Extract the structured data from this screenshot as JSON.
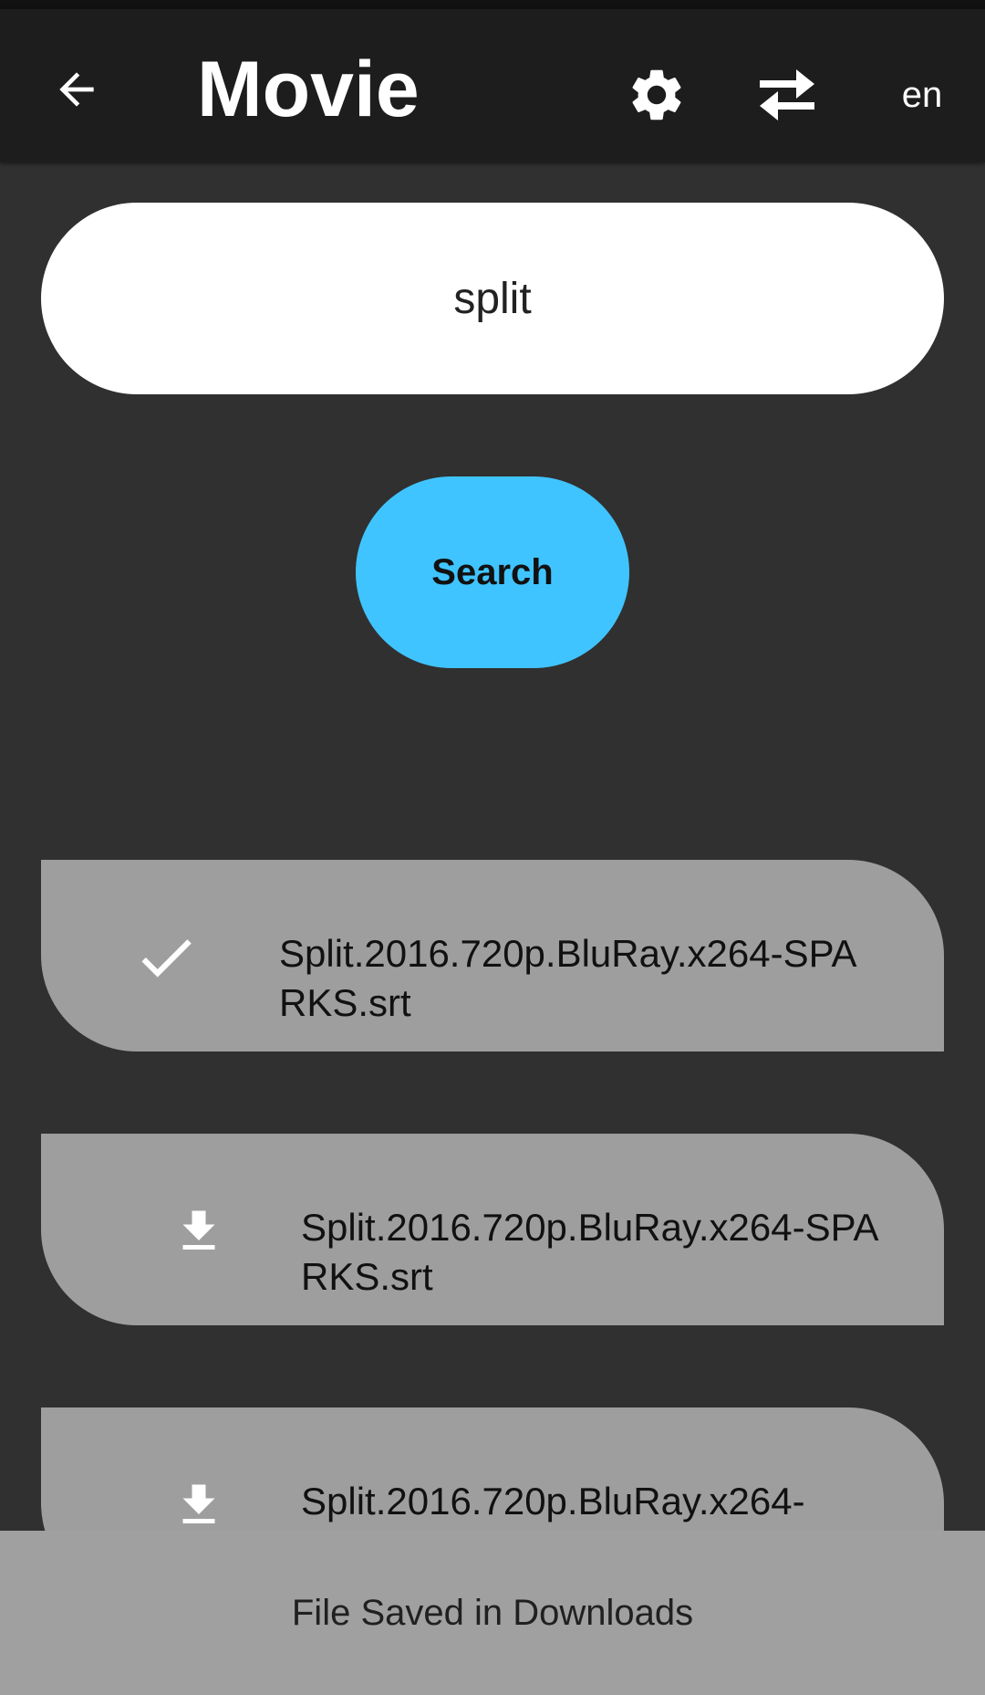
{
  "app_bar": {
    "title": "Movie",
    "language": "en",
    "icons": {
      "back": "arrow-back-icon",
      "settings": "gear-icon",
      "swap": "swap-arrows-icon"
    }
  },
  "search": {
    "value": "split",
    "button_label": "Search"
  },
  "results": [
    {
      "name": "Split.2016.720p.BluRay.x264-SPARKS.srt",
      "status_icon": "check-icon"
    },
    {
      "name": "Split.2016.720p.BluRay.x264-SPARKS.srt",
      "status_icon": "download-icon"
    },
    {
      "name": "Split.2016.720p.BluRay.x264-",
      "status_icon": "download-icon"
    }
  ],
  "snackbar": {
    "message": "File Saved in Downloads"
  },
  "colors": {
    "background": "#303030",
    "app_bar": "#1d1d1d",
    "accent": "#40c4ff",
    "list_item": "#9e9e9e",
    "snackbar": "#a0a0a0"
  }
}
